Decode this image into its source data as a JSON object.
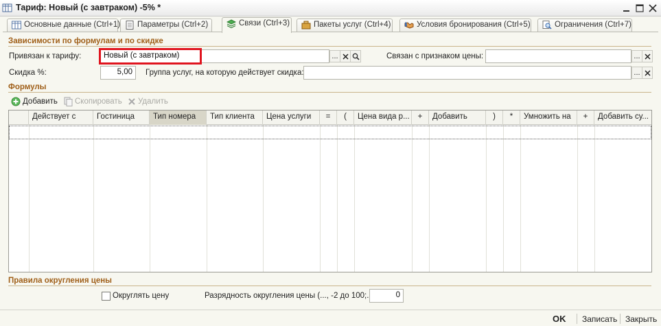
{
  "window": {
    "title": "Тариф: Новый (с завтраком) -5% *"
  },
  "tabs": [
    {
      "label": "Основные данные (Ctrl+1)",
      "icon": "table-icon"
    },
    {
      "label": "Параметры (Ctrl+2)",
      "icon": "document-icon"
    },
    {
      "label": "Связи (Ctrl+3)",
      "icon": "layers-icon",
      "active": true
    },
    {
      "label": "Пакеты услуг (Ctrl+4)",
      "icon": "package-icon"
    },
    {
      "label": "Условия бронирования (Ctrl+5)",
      "icon": "handshake-icon"
    },
    {
      "label": "Ограничения (Ctrl+7)",
      "icon": "search-doc-icon"
    }
  ],
  "dependencies": {
    "title": "Зависимости по формулам и по скидке",
    "tariff_label": "Привязан к тарифу:",
    "tariff_value": "Новый (с завтраком)",
    "price_sign_label": "Связан с признаком цены:",
    "price_sign_value": "",
    "discount_label": "Скидка %:",
    "discount_value": "5,00",
    "service_group_label": "Группа услуг, на которую действует скидка:",
    "service_group_value": "",
    "ellipsis": "...",
    "clear": "✕"
  },
  "formulas": {
    "title": "Формулы",
    "toolbar": {
      "add": "Добавить",
      "copy": "Скопировать",
      "delete": "Удалить"
    },
    "columns": [
      "Действует с",
      "Гостиница",
      "Тип номера",
      "Тип клиента",
      "Цена услуги",
      "=",
      "(",
      "Цена вида р...",
      "+",
      "Добавить",
      ")",
      "*",
      "Умножить на",
      "+",
      "Добавить су..."
    ]
  },
  "rounding": {
    "title": "Правила округления цены",
    "round_label": "Округлять цену",
    "round_checked": false,
    "digits_label": "Разрядность округления цены (..., -2 до 100;...",
    "digits_value": "0"
  },
  "footer": {
    "ok": "OK",
    "save": "Записать",
    "close": "Закрыть"
  }
}
